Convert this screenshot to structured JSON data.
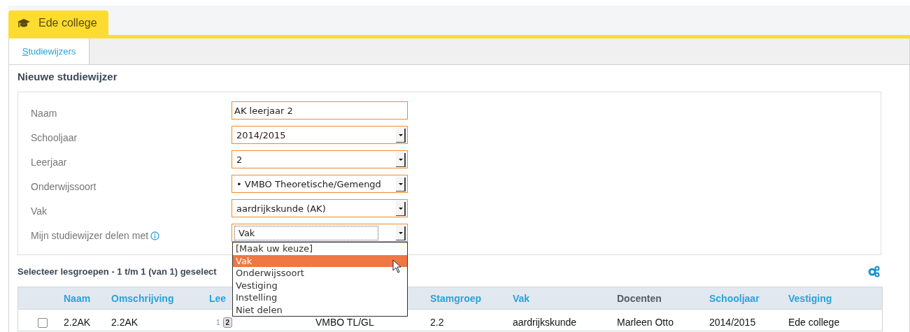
{
  "app_tab": {
    "label": "Ede college",
    "selected": true
  },
  "subtabs": [
    {
      "label": "Studiewijzers",
      "selected": true
    }
  ],
  "title": "Nieuwe studiewijzer",
  "form": {
    "fields": [
      {
        "kind": "text",
        "label": "Naam",
        "value": "AK leerjaar 2"
      },
      {
        "kind": "select",
        "label": "Schooljaar",
        "value": "2014/2015"
      },
      {
        "kind": "select",
        "label": "Leerjaar",
        "value": "2"
      },
      {
        "kind": "select",
        "label": "Onderwijssoort",
        "value": "• VMBO Theoretische/Gemengd"
      },
      {
        "kind": "select",
        "label": "Vak",
        "value": "aardrijkskunde (AK)"
      },
      {
        "kind": "select",
        "label": "Mijn studiewijzer delen met",
        "value": "Vak",
        "info": true,
        "focused": true,
        "options": [
          {
            "label": "[Maak uw keuze]",
            "selected": false
          },
          {
            "label": "Vak",
            "selected": true
          },
          {
            "label": "Onderwijssoort",
            "selected": false
          },
          {
            "label": "Vestiging",
            "selected": false
          },
          {
            "label": "Instelling",
            "selected": false
          },
          {
            "label": "Niet delen",
            "selected": false
          }
        ]
      }
    ]
  },
  "groups": {
    "heading": "Selecteer lesgroepen - 1 t/m 1 (van 1) geselect",
    "table": {
      "columns": [
        {
          "label": "Naam",
          "sortable": true
        },
        {
          "label": "Omschrijving",
          "sortable": true
        },
        {
          "label": "Lee",
          "sortable": true
        },
        {},
        {
          "label": "Stamgroep",
          "sortable": true
        },
        {
          "label": "Vak",
          "sortable": true
        },
        {
          "label": "Docenten",
          "sortable": false
        },
        {
          "label": "Schooljaar",
          "sortable": true
        },
        {
          "label": "Vestiging",
          "sortable": true
        }
      ],
      "rows": [
        {
          "checked": false,
          "naam": "2.2AK",
          "omschrijving": "2.2AK",
          "leerjaar": [
            {
              "label": "1",
              "selected": false
            },
            {
              "label": "2",
              "selected": true
            }
          ],
          "column_4": "VMBO TL/GL",
          "stamgroep": "2.2",
          "vak": "aardrijkskunde",
          "docenten": "Marleen Otto",
          "schooljaar": "2014/2015",
          "vestiging": "Ede college"
        }
      ]
    }
  }
}
